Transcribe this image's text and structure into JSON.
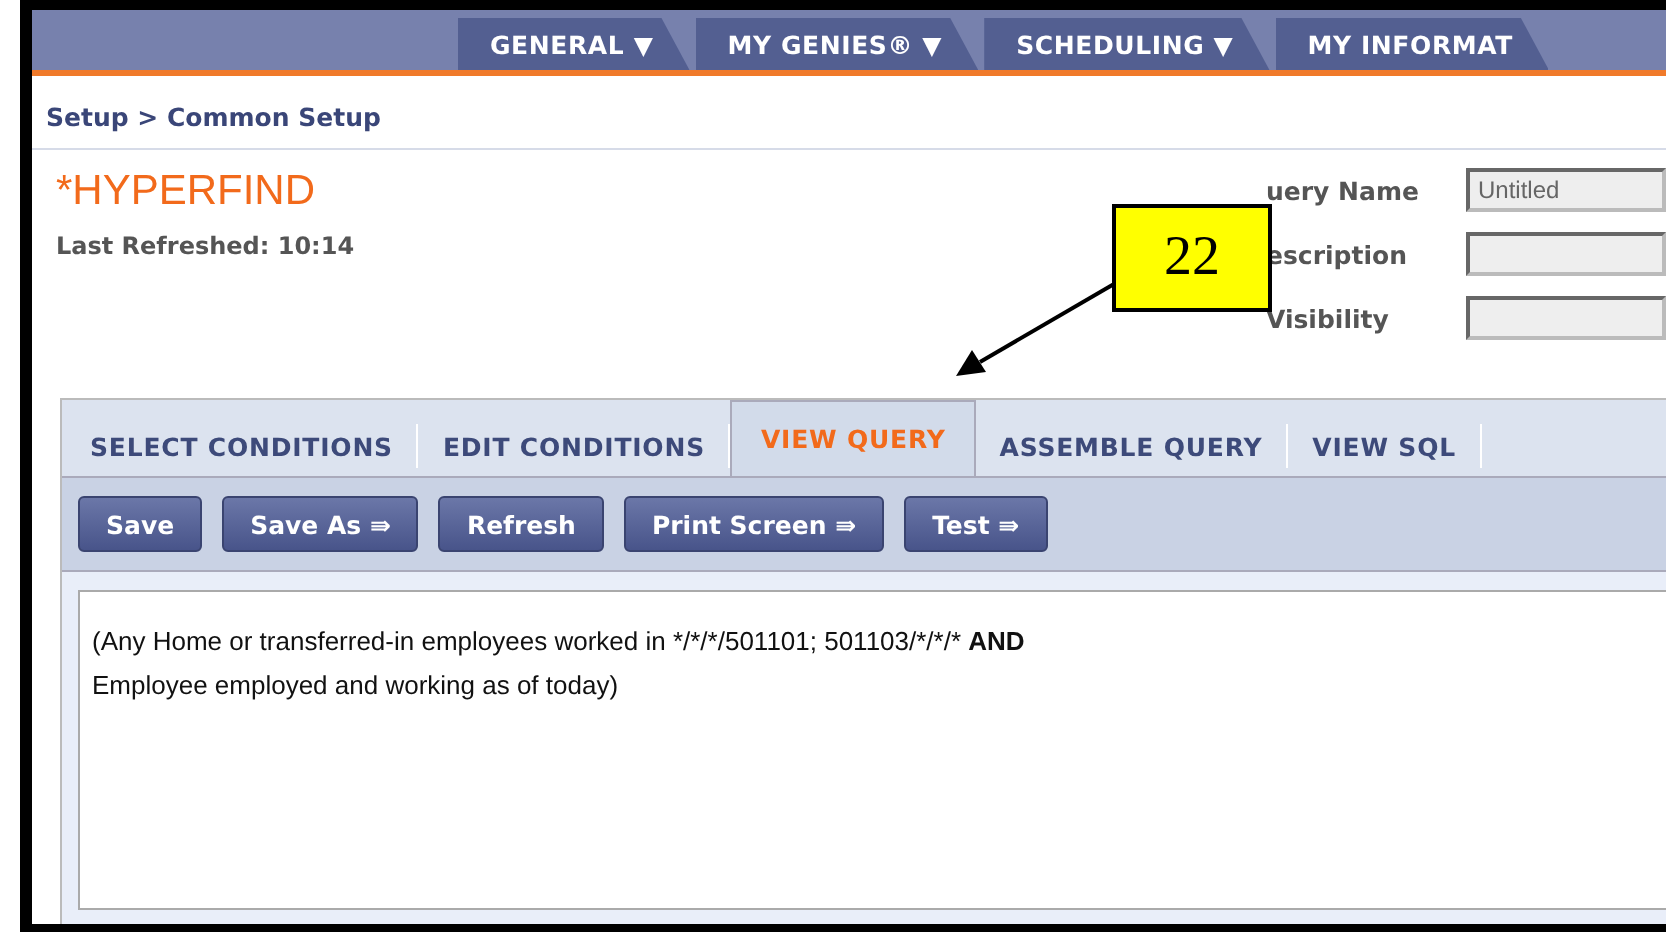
{
  "nav_tabs": [
    {
      "label": "GENERAL ▼"
    },
    {
      "label": "MY GENIES® ▼"
    },
    {
      "label": "SCHEDULING ▼"
    },
    {
      "label": "MY INFORMAT"
    }
  ],
  "breadcrumb": "Setup > Common Setup",
  "title": "*HYPERFIND",
  "last_refreshed": "Last Refreshed: 10:14",
  "fields": [
    {
      "label": "uery Name",
      "value": "Untitled"
    },
    {
      "label": "escription"
    },
    {
      "label": "Visibility"
    }
  ],
  "callout": {
    "text": "22"
  },
  "tabs": [
    {
      "label": "SELECT CONDITIONS",
      "selected": false
    },
    {
      "label": "EDIT CONDITIONS",
      "selected": false
    },
    {
      "label": "VIEW QUERY",
      "selected": true
    },
    {
      "label": "ASSEMBLE QUERY",
      "selected": false
    },
    {
      "label": "VIEW SQL",
      "selected": false
    }
  ],
  "buttons": [
    "Save",
    "Save As ⇛",
    "Refresh",
    "Print Screen ⇛",
    "Test ⇛"
  ],
  "query": {
    "text_before": "(Any Home or transferred-in employees worked in */*/*/501101; 501103/*/*/* ",
    "emphasis": "AND",
    "text_after": "\nEmployee employed and working as of today)"
  }
}
